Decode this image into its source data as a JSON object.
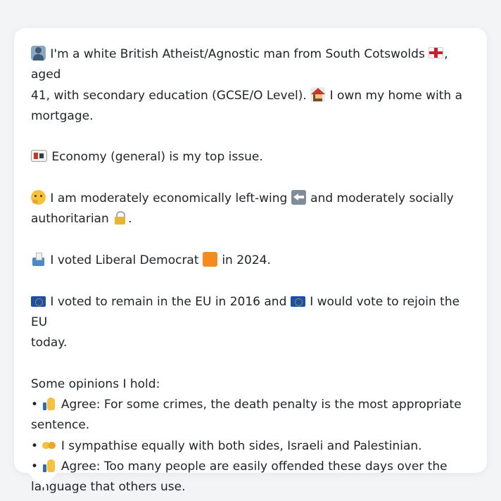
{
  "profile": {
    "intro_1": "I'm a white British Atheist/Agnostic man from South Cotswolds",
    "intro_2": ", aged",
    "intro_3": "41, with secondary education (GCSE/O Level).",
    "intro_4": "I own my home with a",
    "intro_5": "mortgage.",
    "issue": "Economy (general) is my top issue.",
    "ideology_1": "I am moderately economically left-wing",
    "ideology_2": "and moderately socially",
    "ideology_3": "authoritarian",
    "ideology_4": ".",
    "vote_1": "I voted Liberal Democrat",
    "vote_2": "in 2024.",
    "eu_1": "I voted to remain in the EU in 2016 and",
    "eu_2": "I would vote to rejoin the EU",
    "eu_3": "today.",
    "opinions_heading": "Some opinions I hold:",
    "opinions": [
      {
        "bullet": "•",
        "line_1": "Agree: For some crimes, the death penalty is the most appropriate",
        "line_2": "sentence."
      },
      {
        "bullet": "•",
        "line_1": "I sympathise equally with both sides, Israeli and Palestinian."
      },
      {
        "bullet": "•",
        "line_1": "Agree: Too many people are easily offended these days over the",
        "line_2": "language that others use."
      }
    ]
  },
  "icons": {
    "person": "person-icon",
    "flag": "england-flag-icon",
    "house": "house-icon",
    "money": "money-icon",
    "think": "thinking-face-icon",
    "left": "left-arrow-icon",
    "lock": "padlock-icon",
    "ballot": "ballot-box-icon",
    "party": "orange-square-icon",
    "eu": "eu-flag-icon",
    "agree": "thumbs-up-icon",
    "neutral": "handshake-icon"
  },
  "colors": {
    "background": "#f3f4f6",
    "card": "#ffffff",
    "text": "#1f2328",
    "party": "#f58a1f"
  }
}
